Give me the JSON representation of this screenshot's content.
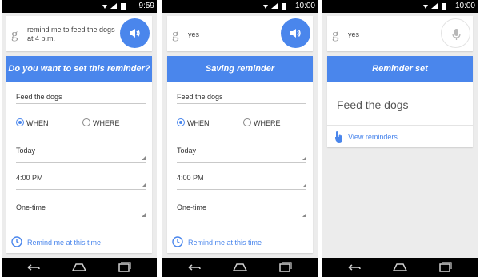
{
  "screens": [
    {
      "status_time": "9:59",
      "query": "remind me to feed the dogs at 4 p.m.",
      "action_icon": "speaker-icon",
      "header": "Do you want to set this reminder?",
      "title_field": "Feed the dogs",
      "radio_when": "WHEN",
      "radio_where": "WHERE",
      "date": "Today",
      "time": "4:00 PM",
      "repeat": "One-time",
      "remind_link": "Remind me at this time"
    },
    {
      "status_time": "10:00",
      "query": "yes",
      "action_icon": "speaker-icon",
      "header": "Saving reminder",
      "title_field": "Feed the dogs",
      "radio_when": "WHEN",
      "radio_where": "WHERE",
      "date": "Today",
      "time": "4:00 PM",
      "repeat": "One-time",
      "remind_link": "Remind me at this time"
    },
    {
      "status_time": "10:00",
      "query": "yes",
      "action_icon": "microphone-icon",
      "header": "Reminder set",
      "title": "Feed the dogs",
      "view_link": "View reminders"
    }
  ],
  "google_logo": "g",
  "colors": {
    "accent": "#4a86ec",
    "background": "#ececec",
    "statusbar": "#000000"
  }
}
